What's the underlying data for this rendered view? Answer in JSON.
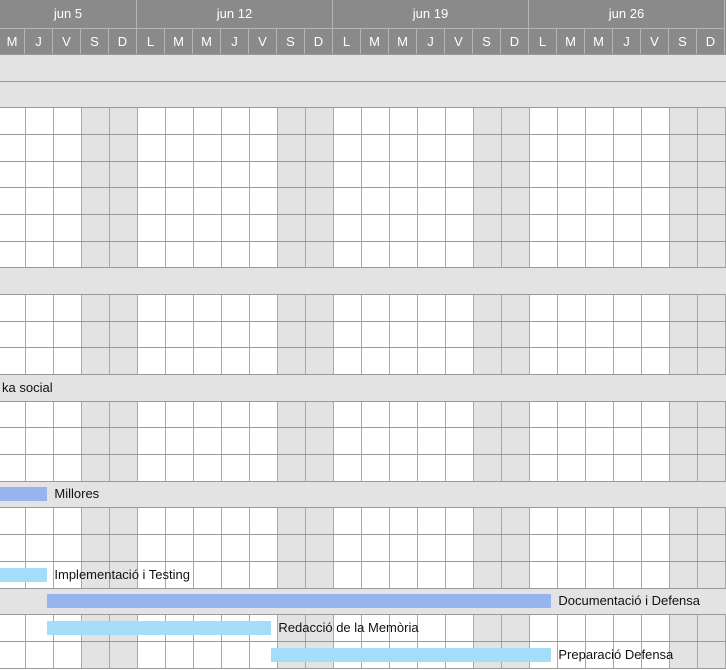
{
  "weeks": [
    "jun 5",
    "jun 12",
    "jun 19",
    "jun 26"
  ],
  "days": [
    "M",
    "J",
    "V",
    "S",
    "D",
    "L",
    "M",
    "M",
    "J",
    "V",
    "S",
    "D",
    "L",
    "M",
    "M",
    "J",
    "V",
    "S",
    "D",
    "L",
    "M",
    "M",
    "J",
    "V",
    "S",
    "D"
  ],
  "weekend_indices": [
    3,
    4,
    10,
    11,
    17,
    18,
    24,
    25
  ],
  "colors": {
    "header": "#8a8a8a",
    "group_row": "#e3e3e3",
    "bar_blue": "#98b4ee",
    "bar_cyan": "#a3ddf7"
  },
  "rows": [
    {
      "type": "group",
      "label": ""
    },
    {
      "type": "group",
      "label": ""
    },
    {
      "type": "task",
      "label": ""
    },
    {
      "type": "task",
      "label": ""
    },
    {
      "type": "task",
      "label": ""
    },
    {
      "type": "task",
      "label": ""
    },
    {
      "type": "task",
      "label": ""
    },
    {
      "type": "task",
      "label": ""
    },
    {
      "type": "group",
      "label": ""
    },
    {
      "type": "task",
      "label": ""
    },
    {
      "type": "task",
      "label": ""
    },
    {
      "type": "task",
      "label": ""
    },
    {
      "type": "group",
      "label": "ka social"
    },
    {
      "type": "task",
      "label": ""
    },
    {
      "type": "task",
      "label": ""
    },
    {
      "type": "task",
      "label": ""
    },
    {
      "type": "group",
      "label": "",
      "bar": {
        "start_day": -1,
        "end_day": 1.8,
        "color": "bar_blue",
        "label": "Millores"
      }
    },
    {
      "type": "task",
      "label": ""
    },
    {
      "type": "task",
      "label": ""
    },
    {
      "type": "task",
      "label": "",
      "bar": {
        "start_day": -1,
        "end_day": 1.8,
        "color": "bar_cyan",
        "label": "Implementació i Testing"
      }
    },
    {
      "type": "group",
      "label": "",
      "bar": {
        "start_day": 1.8,
        "end_day": 19.8,
        "color": "bar_blue",
        "label": "Documentació i Defensa"
      }
    },
    {
      "type": "task",
      "label": "",
      "bar": {
        "start_day": 1.8,
        "end_day": 9.8,
        "color": "bar_cyan",
        "label": "Redacció de la Memòria"
      }
    },
    {
      "type": "task",
      "label": "",
      "bar": {
        "start_day": 9.8,
        "end_day": 19.8,
        "color": "bar_cyan",
        "label": "Preparació Defensa"
      }
    }
  ]
}
